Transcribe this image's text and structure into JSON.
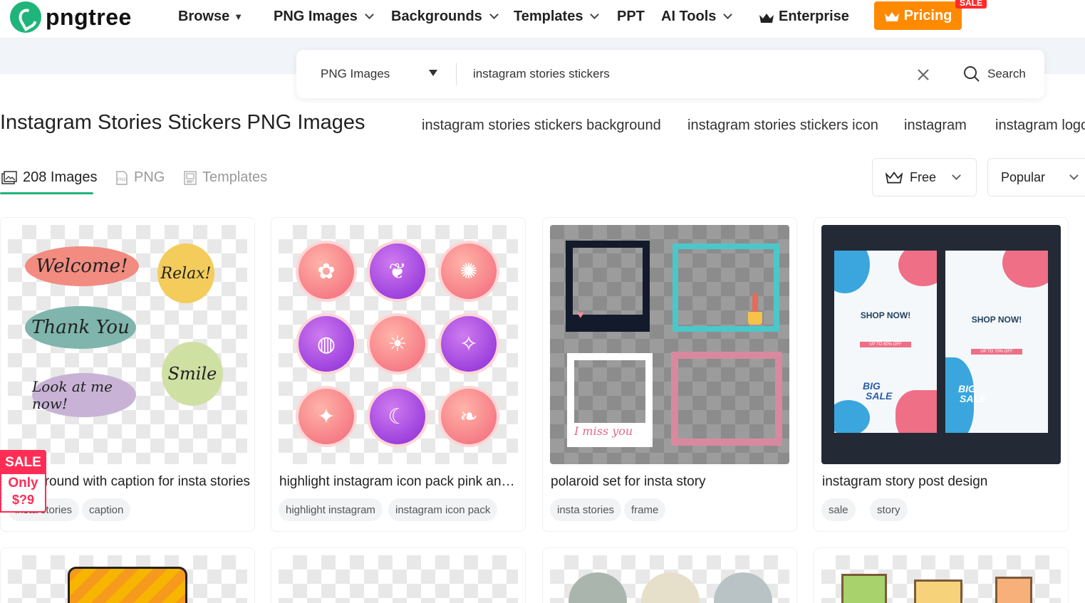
{
  "brand": {
    "logo_text": "pngtree"
  },
  "nav": {
    "items": [
      {
        "label": "Browse"
      },
      {
        "label": "PNG Images"
      },
      {
        "label": "Backgrounds"
      },
      {
        "label": "Templates"
      },
      {
        "label": "PPT"
      },
      {
        "label": "AI Tools"
      },
      {
        "label": "Enterprise"
      }
    ],
    "pricing_label": "Pricing",
    "sale_tag": "SALE"
  },
  "search": {
    "type_label": "PNG Images",
    "query": "instagram stories stickers",
    "button_label": "Search"
  },
  "page": {
    "title": "Instagram Stories Stickers PNG Images",
    "related": [
      "instagram stories stickers background",
      "instagram stories stickers icon",
      "instagram",
      "instagram logo"
    ]
  },
  "tabs": [
    {
      "label": "208 Images"
    },
    {
      "label": "PNG"
    },
    {
      "label": "Templates"
    }
  ],
  "filters": {
    "license": "Free",
    "sort": "Popular"
  },
  "cards": [
    {
      "title": "background with caption for insta stories",
      "tags": [
        "insta stories",
        "caption"
      ],
      "stickers": [
        "Welcome!",
        "Relax!",
        "Thank You",
        "Smile",
        "Look at me now!"
      ]
    },
    {
      "title": "highlight instagram icon pack pink and purple",
      "tags": [
        "highlight instagram",
        "instagram icon pack"
      ]
    },
    {
      "title": "polaroid set for insta story",
      "tags": [
        "insta stories",
        "frame"
      ],
      "polaroid_caption": "I miss you"
    },
    {
      "title": "instagram story post design",
      "tags": [
        "sale",
        "story"
      ],
      "poster": {
        "headline": "SHOP NOW!",
        "offer_a": "UP TO 60% OFF",
        "offer_b": "UP TO 70% OFF",
        "big": "BIG",
        "sale": "SALE"
      }
    }
  ],
  "promo": {
    "line1": "SALE",
    "line2": "Only",
    "line3": "$?9"
  },
  "colors": {
    "brand_green": "#1fb57a",
    "pricing_orange": "#ff8a00",
    "sale_red": "#ff2d55"
  }
}
